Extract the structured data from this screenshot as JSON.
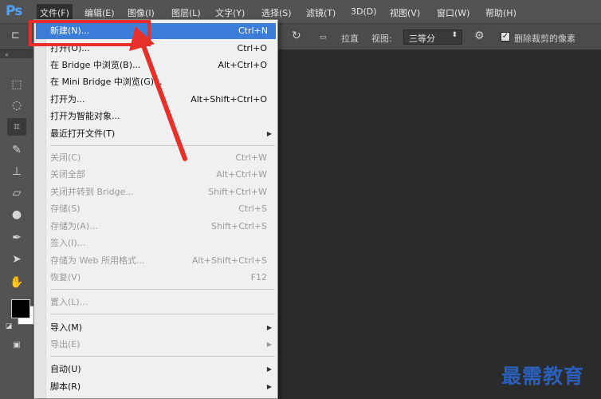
{
  "app": {
    "logo": "Ps"
  },
  "menubar": {
    "items": [
      {
        "label": "文件(F)"
      },
      {
        "label": "编辑(E)"
      },
      {
        "label": "图像(I)"
      },
      {
        "label": "图层(L)"
      },
      {
        "label": "文字(Y)"
      },
      {
        "label": "选择(S)"
      },
      {
        "label": "滤镜(T)"
      },
      {
        "label": "3D(D)"
      },
      {
        "label": "视图(V)"
      },
      {
        "label": "窗口(W)"
      },
      {
        "label": "帮助(H)"
      }
    ]
  },
  "options": {
    "straighten_label": "拉直",
    "view_label": "视图:",
    "view_value": "三等分",
    "delete_crop_label": "删除裁剪的像素",
    "delete_crop_checked": true
  },
  "file_menu": {
    "items": [
      {
        "label": "新建(N)...",
        "shortcut": "Ctrl+N",
        "enabled": true,
        "highlighted": true
      },
      {
        "label": "打开(O)...",
        "shortcut": "Ctrl+O",
        "enabled": true
      },
      {
        "label": "在 Bridge 中浏览(B)...",
        "shortcut": "Alt+Ctrl+O",
        "enabled": true
      },
      {
        "label": "在 Mini Bridge 中浏览(G)...",
        "shortcut": "",
        "enabled": true
      },
      {
        "label": "打开为...",
        "shortcut": "Alt+Shift+Ctrl+O",
        "enabled": true
      },
      {
        "label": "打开为智能对象...",
        "shortcut": "",
        "enabled": true
      },
      {
        "label": "最近打开文件(T)",
        "shortcut": "",
        "enabled": true,
        "submenu": true
      },
      {
        "label": "关闭(C)",
        "shortcut": "Ctrl+W",
        "enabled": false
      },
      {
        "label": "关闭全部",
        "shortcut": "Alt+Ctrl+W",
        "enabled": false
      },
      {
        "label": "关闭并转到 Bridge...",
        "shortcut": "Shift+Ctrl+W",
        "enabled": false
      },
      {
        "label": "存储(S)",
        "shortcut": "Ctrl+S",
        "enabled": false
      },
      {
        "label": "存储为(A)...",
        "shortcut": "Shift+Ctrl+S",
        "enabled": false
      },
      {
        "label": "签入(I)...",
        "shortcut": "",
        "enabled": false
      },
      {
        "label": "存储为 Web 所用格式...",
        "shortcut": "Alt+Shift+Ctrl+S",
        "enabled": false
      },
      {
        "label": "恢复(V)",
        "shortcut": "F12",
        "enabled": false
      },
      {
        "label": "置入(L)...",
        "shortcut": "",
        "enabled": false
      },
      {
        "label": "导入(M)",
        "shortcut": "",
        "enabled": true,
        "submenu": true
      },
      {
        "label": "导出(E)",
        "shortcut": "",
        "enabled": false,
        "submenu": true
      },
      {
        "label": "自动(U)",
        "shortcut": "",
        "enabled": true,
        "submenu": true
      },
      {
        "label": "脚本(R)",
        "shortcut": "",
        "enabled": true,
        "submenu": true
      }
    ]
  },
  "tools": [
    "marquee-icon",
    "lasso-icon",
    "crop-icon",
    "eyedropper-icon",
    "stamp-icon",
    "eraser-icon",
    "blur-icon",
    "pen-icon",
    "path-select-icon",
    "hand-icon"
  ],
  "colors": {
    "foreground": "#000000",
    "background": "#ffffff",
    "highlight": "#3b7dd8",
    "annotation": "#e8302a",
    "watermark": "#2b5fb8"
  },
  "watermark": {
    "text": "最需教育"
  }
}
